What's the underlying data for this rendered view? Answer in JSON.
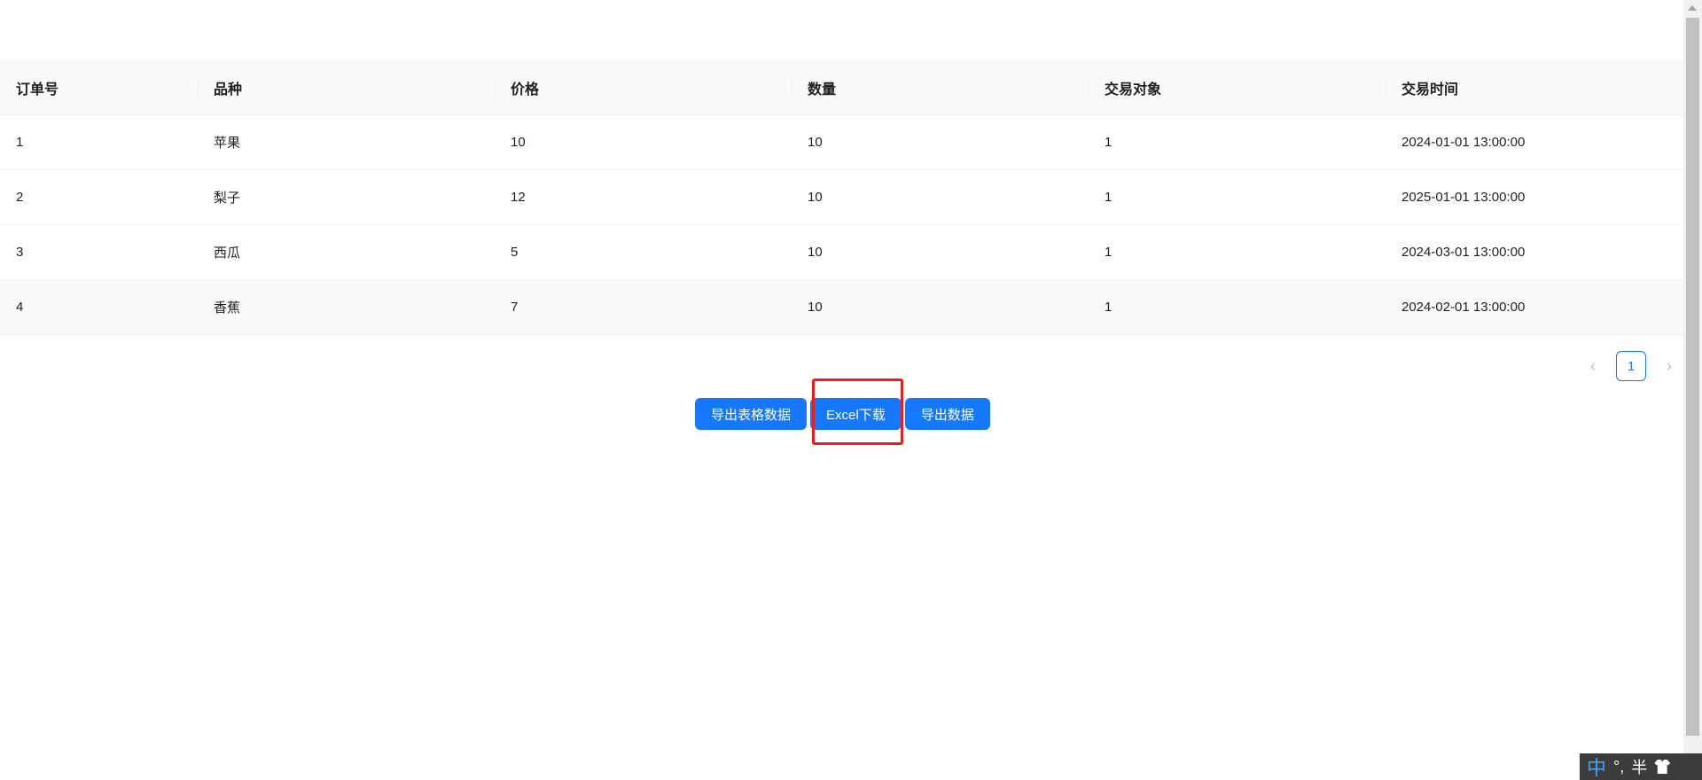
{
  "table": {
    "columns": [
      "订单号",
      "品种",
      "价格",
      "数量",
      "交易对象",
      "交易时间"
    ],
    "rows": [
      [
        "1",
        "苹果",
        "10",
        "10",
        "1",
        "2024-01-01 13:00:00"
      ],
      [
        "2",
        "梨子",
        "12",
        "10",
        "1",
        "2025-01-01 13:00:00"
      ],
      [
        "3",
        "西瓜",
        "5",
        "10",
        "1",
        "2024-03-01 13:00:00"
      ],
      [
        "4",
        "香蕉",
        "7",
        "10",
        "1",
        "2024-02-01 13:00:00"
      ]
    ]
  },
  "pagination": {
    "prev_icon": "‹",
    "current_page": "1",
    "next_icon": "›"
  },
  "buttons": {
    "export_table": "导出表格数据",
    "excel_download": "Excel下载",
    "export_data": "导出数据"
  },
  "ime": {
    "mode": "中",
    "punct": "°,",
    "width": "半"
  },
  "colors": {
    "primary": "#1677ff",
    "highlight": "#ee1c1c",
    "header_bg": "#fafafa"
  }
}
